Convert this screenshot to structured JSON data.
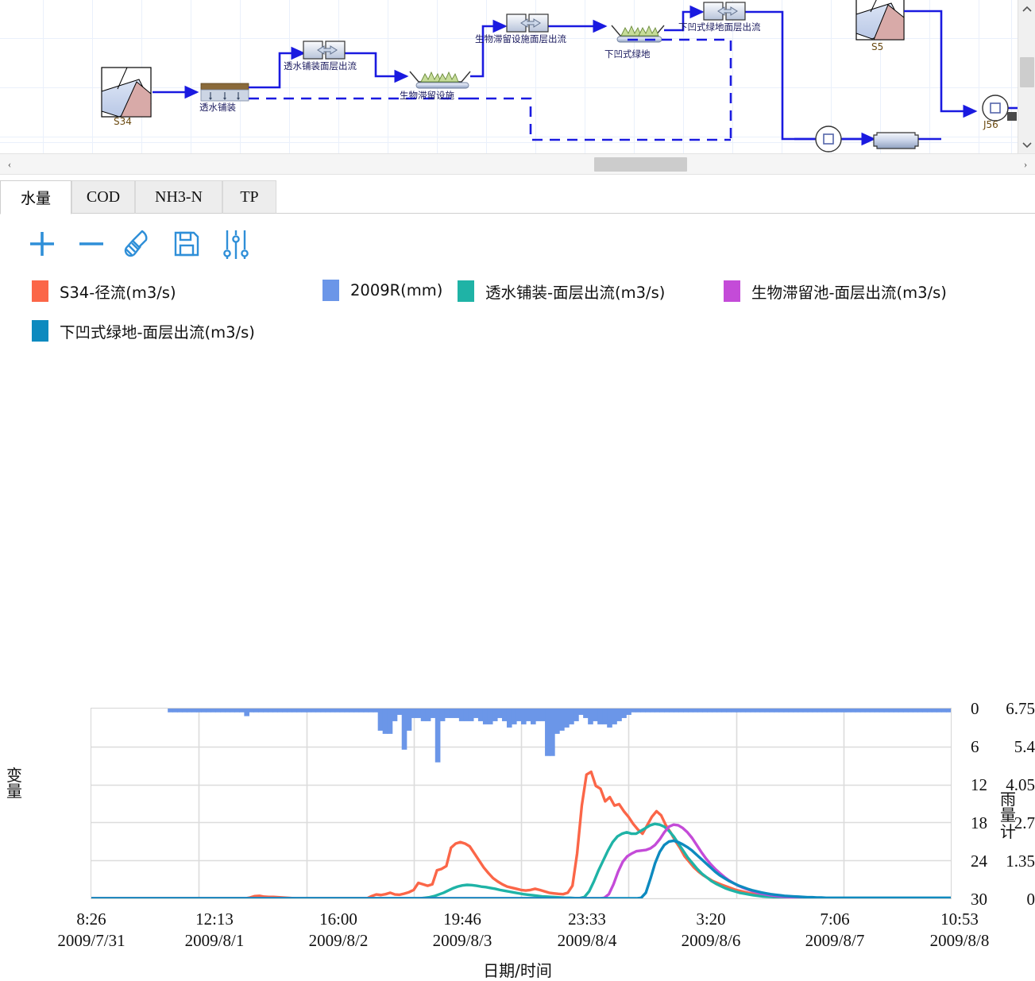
{
  "diagram": {
    "nodes": [
      {
        "id": "s34",
        "label": "S34",
        "type": "subcatchment-icon"
      },
      {
        "id": "permeable",
        "label": "透水铺装",
        "type": "permeable-pavement-icon"
      },
      {
        "id": "bioretention",
        "label": "生物滞留设施",
        "type": "bioretention-icon"
      },
      {
        "id": "sunken",
        "label": "下凹式绿地",
        "type": "sunken-green-icon"
      },
      {
        "id": "s5",
        "label": "S5",
        "type": "subcatchment-icon"
      },
      {
        "id": "j56",
        "label": "J56",
        "type": "junction-icon"
      }
    ],
    "link_labels": [
      "透水铺装面层出流",
      "生物滞留设施面层出流",
      "下凹式绿地面层出流"
    ],
    "scroll": {
      "up": "▲",
      "down": "▼",
      "left": "‹",
      "right": "›"
    }
  },
  "tabs": [
    {
      "label": "水量",
      "active": true
    },
    {
      "label": "COD",
      "active": false
    },
    {
      "label": "NH3-N",
      "active": false
    },
    {
      "label": "TP",
      "active": false
    }
  ],
  "toolbar": [
    {
      "name": "add-series-button",
      "icon": "plus-icon",
      "label": "+"
    },
    {
      "name": "remove-series-button",
      "icon": "minus-icon",
      "label": "−"
    },
    {
      "name": "clear-button",
      "icon": "broom-icon",
      "label": ""
    },
    {
      "name": "save-button",
      "icon": "floppy-disk-icon",
      "label": ""
    },
    {
      "name": "settings-button",
      "icon": "sliders-icon",
      "label": ""
    }
  ],
  "chart_data": {
    "type": "line",
    "title": "",
    "xlabel": "日期/时间",
    "ylabel": "变量",
    "ylabel_right": "雨量计",
    "ylim": [
      0,
      6.75
    ],
    "ylim_right": [
      0,
      30
    ],
    "right_axis_inverted": true,
    "grid": true,
    "legend_position": "top",
    "yticks": [
      "6.75",
      "5.4",
      "4.05",
      "2.7",
      "1.35",
      "0"
    ],
    "yticks_right": [
      "0",
      "6",
      "12",
      "18",
      "24",
      "30"
    ],
    "xticks": [
      {
        "time": "8:26",
        "date": "2009/7/31"
      },
      {
        "time": "12:13",
        "date": "2009/8/1"
      },
      {
        "time": "16:00",
        "date": "2009/8/2"
      },
      {
        "time": "19:46",
        "date": "2009/8/3"
      },
      {
        "time": "23:33",
        "date": "2009/8/4"
      },
      {
        "time": "3:20",
        "date": "2009/8/6"
      },
      {
        "time": "7:06",
        "date": "2009/8/7"
      },
      {
        "time": "10:53",
        "date": "2009/8/8"
      }
    ],
    "series": [
      {
        "name": "S34-径流(m3/s)",
        "color": "#fb6648",
        "axis": "left",
        "render": "line",
        "values": [
          0,
          0,
          0,
          0,
          0,
          0,
          0,
          0,
          0,
          0,
          0,
          0,
          0,
          0,
          0,
          0,
          0,
          0,
          0,
          0,
          0,
          0,
          0,
          0,
          0,
          0,
          0,
          0,
          0,
          0,
          0,
          0,
          0,
          0,
          0.03,
          0.08,
          0.09,
          0.06,
          0.05,
          0.05,
          0.04,
          0.03,
          0.02,
          0.01,
          0,
          0,
          0,
          0,
          0,
          0,
          0,
          0,
          0,
          0,
          0,
          0,
          0,
          0,
          0,
          0,
          0.08,
          0.14,
          0.12,
          0.15,
          0.2,
          0.14,
          0.13,
          0.17,
          0.22,
          0.3,
          0.55,
          0.5,
          0.45,
          0.5,
          1.0,
          1.05,
          1.15,
          1.8,
          1.95,
          2.0,
          1.95,
          1.85,
          1.6,
          1.35,
          1.1,
          0.9,
          0.72,
          0.6,
          0.5,
          0.42,
          0.38,
          0.34,
          0.3,
          0.28,
          0.3,
          0.34,
          0.3,
          0.25,
          0.2,
          0.18,
          0.16,
          0.15,
          0.2,
          0.45,
          1.6,
          3.3,
          4.4,
          4.5,
          4.0,
          3.9,
          3.45,
          3.6,
          3.3,
          3.35,
          3.1,
          2.9,
          2.65,
          2.45,
          2.3,
          2.6,
          2.9,
          3.1,
          2.95,
          2.6,
          2.35,
          2.05,
          1.8,
          1.5,
          1.3,
          1.1,
          0.95,
          0.82,
          0.72,
          0.62,
          0.55,
          0.48,
          0.42,
          0.36,
          0.3,
          0.26,
          0.22,
          0.18,
          0.15,
          0.12,
          0.1,
          0.08,
          0.06,
          0.05,
          0.04,
          0.03,
          0.02,
          0.02,
          0.01,
          0.01,
          0,
          0,
          0,
          0,
          0,
          0,
          0,
          0,
          0,
          0,
          0,
          0,
          0,
          0,
          0,
          0,
          0,
          0,
          0,
          0,
          0,
          0,
          0,
          0,
          0,
          0,
          0,
          0,
          0,
          0,
          0
        ]
      },
      {
        "name": "2009R(mm)",
        "color": "#6b96e8",
        "axis": "right",
        "render": "bar-down",
        "values": [
          0,
          0,
          0,
          0,
          0,
          0,
          0,
          0,
          0,
          0,
          0,
          0,
          0,
          0,
          0,
          0,
          0.6,
          0.6,
          0.6,
          0.6,
          0.6,
          0.6,
          0.6,
          0.6,
          0.6,
          0.6,
          0.6,
          0.6,
          0.6,
          0.6,
          0.6,
          0.6,
          1.2,
          0.6,
          0.6,
          0.6,
          0.6,
          0.6,
          0.6,
          0.6,
          0.6,
          0.6,
          0.6,
          0.6,
          0.6,
          0.6,
          0.6,
          0.6,
          0.6,
          0.6,
          0.6,
          0.6,
          0.6,
          0.6,
          0.6,
          0.6,
          0.6,
          0.6,
          0.6,
          0.6,
          3.5,
          4.0,
          4.0,
          2.0,
          1.0,
          6.5,
          3.5,
          1.5,
          1.5,
          2.0,
          2.0,
          1.5,
          8.5,
          2.0,
          1.5,
          1.5,
          1.5,
          2.0,
          2.0,
          2.0,
          1.5,
          2.0,
          2.5,
          2.5,
          2.0,
          1.5,
          2.0,
          3.0,
          2.5,
          2.0,
          2.5,
          2.0,
          2.5,
          2.0,
          2.0,
          7.5,
          7.5,
          4.0,
          3.5,
          3.0,
          2.5,
          2.0,
          1.0,
          1.5,
          2.5,
          2.0,
          2.5,
          2.5,
          3.0,
          2.5,
          2.0,
          1.5,
          1.0,
          0.6,
          0.6,
          0.6,
          0.6,
          0.6,
          0.6,
          0.6,
          0.6,
          0.6,
          0.6,
          0.6,
          0.6,
          0.6,
          0.6,
          0.6,
          0.6,
          0.6,
          0.6,
          0.6,
          0.6,
          0.6,
          0.6,
          0.6,
          0.6,
          0.6,
          0.6,
          0.6,
          0.6,
          0.6,
          0.6,
          0.6,
          0.6,
          0.6,
          0.6,
          0.6,
          0.6,
          0.6,
          0.6,
          0.6,
          0.6,
          0.6,
          0.6,
          0.6,
          0.6,
          0.6,
          0.6,
          0.6,
          0.6,
          0.6,
          0.6,
          0.6,
          0.6,
          0.6,
          0.6,
          0.6,
          0.6,
          0.6,
          0.6,
          0.6,
          0.6,
          0.6,
          0.6,
          0.6,
          0.6,
          0.6,
          0.6,
          0.6
        ]
      },
      {
        "name": "透水铺装-面层出流(m3/s)",
        "color": "#1fb3a6",
        "axis": "left",
        "render": "line",
        "values": [
          0,
          0,
          0,
          0,
          0,
          0,
          0,
          0,
          0,
          0,
          0,
          0,
          0,
          0,
          0,
          0,
          0,
          0,
          0,
          0,
          0,
          0,
          0,
          0,
          0,
          0,
          0,
          0,
          0,
          0,
          0,
          0,
          0,
          0,
          0,
          0,
          0,
          0,
          0,
          0,
          0,
          0,
          0,
          0,
          0,
          0,
          0,
          0,
          0,
          0,
          0,
          0,
          0,
          0,
          0,
          0,
          0,
          0,
          0,
          0,
          0,
          0,
          0,
          0,
          0,
          0,
          0,
          0,
          0,
          0,
          0,
          0.02,
          0.04,
          0.08,
          0.14,
          0.2,
          0.28,
          0.36,
          0.42,
          0.46,
          0.48,
          0.47,
          0.45,
          0.42,
          0.4,
          0.37,
          0.34,
          0.3,
          0.27,
          0.24,
          0.21,
          0.18,
          0.15,
          0.13,
          0.11,
          0.09,
          0.07,
          0.06,
          0.05,
          0.04,
          0.03,
          0.02,
          0.02,
          0.01,
          0.01,
          0.05,
          0.25,
          0.6,
          1.0,
          1.35,
          1.7,
          2.0,
          2.2,
          2.3,
          2.35,
          2.3,
          2.3,
          2.4,
          2.5,
          2.6,
          2.65,
          2.62,
          2.55,
          2.4,
          2.2,
          1.95,
          1.7,
          1.45,
          1.25,
          1.05,
          0.88,
          0.75,
          0.62,
          0.52,
          0.44,
          0.36,
          0.3,
          0.25,
          0.2,
          0.17,
          0.14,
          0.11,
          0.09,
          0.07,
          0.06,
          0.05,
          0.04,
          0.03,
          0.02,
          0.02,
          0.01,
          0.01,
          0.01,
          0,
          0,
          0,
          0,
          0,
          0,
          0,
          0,
          0,
          0,
          0,
          0,
          0,
          0,
          0,
          0,
          0,
          0,
          0,
          0,
          0,
          0,
          0,
          0,
          0,
          0,
          0,
          0,
          0,
          0,
          0
        ]
      },
      {
        "name": "生物滞留池-面层出流(m3/s)",
        "color": "#c44bd8",
        "axis": "left",
        "render": "line",
        "values": [
          0,
          0,
          0,
          0,
          0,
          0,
          0,
          0,
          0,
          0,
          0,
          0,
          0,
          0,
          0,
          0,
          0,
          0,
          0,
          0,
          0,
          0,
          0,
          0,
          0,
          0,
          0,
          0,
          0,
          0,
          0,
          0,
          0,
          0,
          0,
          0,
          0,
          0,
          0,
          0,
          0,
          0,
          0,
          0,
          0,
          0,
          0,
          0,
          0,
          0,
          0,
          0,
          0,
          0,
          0,
          0,
          0,
          0,
          0,
          0,
          0,
          0,
          0,
          0,
          0,
          0,
          0,
          0,
          0,
          0,
          0,
          0,
          0,
          0,
          0,
          0,
          0,
          0,
          0,
          0,
          0,
          0,
          0,
          0,
          0,
          0,
          0,
          0,
          0,
          0,
          0,
          0,
          0,
          0,
          0,
          0,
          0,
          0,
          0,
          0,
          0,
          0,
          0,
          0,
          0,
          0,
          0,
          0,
          0,
          0,
          0,
          0.02,
          0.15,
          0.5,
          0.95,
          1.3,
          1.5,
          1.6,
          1.68,
          1.7,
          1.72,
          1.78,
          1.9,
          2.1,
          2.35,
          2.55,
          2.62,
          2.6,
          2.5,
          2.35,
          2.15,
          1.9,
          1.65,
          1.42,
          1.22,
          1.05,
          0.9,
          0.76,
          0.64,
          0.54,
          0.45,
          0.38,
          0.32,
          0.26,
          0.21,
          0.17,
          0.14,
          0.11,
          0.09,
          0.07,
          0.06,
          0.05,
          0.04,
          0.03,
          0.02,
          0.02,
          0.01,
          0.01,
          0,
          0,
          0,
          0,
          0,
          0,
          0,
          0,
          0,
          0,
          0,
          0,
          0,
          0,
          0,
          0,
          0,
          0,
          0,
          0,
          0,
          0,
          0,
          0,
          0,
          0,
          0,
          0,
          0
        ]
      },
      {
        "name": "下凹式绿地-面层出流(m3/s)",
        "color": "#0d8abf",
        "axis": "left",
        "render": "line",
        "values": [
          0,
          0,
          0,
          0,
          0,
          0,
          0,
          0,
          0,
          0,
          0,
          0,
          0,
          0,
          0,
          0,
          0,
          0,
          0,
          0,
          0,
          0,
          0,
          0,
          0,
          0,
          0,
          0,
          0,
          0,
          0,
          0,
          0,
          0,
          0,
          0,
          0,
          0,
          0,
          0,
          0,
          0,
          0,
          0,
          0,
          0,
          0,
          0,
          0,
          0,
          0,
          0,
          0,
          0,
          0,
          0,
          0,
          0,
          0,
          0,
          0,
          0,
          0,
          0,
          0,
          0,
          0,
          0,
          0,
          0,
          0,
          0,
          0,
          0,
          0,
          0,
          0,
          0,
          0,
          0,
          0,
          0,
          0,
          0,
          0,
          0,
          0,
          0,
          0,
          0,
          0,
          0,
          0,
          0,
          0,
          0,
          0,
          0,
          0,
          0,
          0,
          0,
          0,
          0,
          0,
          0,
          0,
          0,
          0,
          0,
          0,
          0,
          0,
          0,
          0,
          0,
          0,
          0,
          0,
          0.02,
          0.2,
          0.7,
          1.25,
          1.65,
          1.9,
          2.02,
          2.05,
          2.0,
          1.92,
          1.82,
          1.7,
          1.55,
          1.4,
          1.25,
          1.1,
          0.95,
          0.82,
          0.72,
          0.62,
          0.54,
          0.46,
          0.4,
          0.34,
          0.29,
          0.25,
          0.21,
          0.18,
          0.15,
          0.13,
          0.11,
          0.09,
          0.08,
          0.07,
          0.06,
          0.05,
          0.04,
          0.04,
          0.03,
          0.03,
          0.02,
          0.02,
          0.02,
          0.02,
          0.02,
          0.02,
          0.02,
          0.02,
          0.02,
          0.02,
          0.02,
          0.02,
          0.02,
          0.02,
          0.02,
          0.02,
          0.02,
          0.02,
          0.02,
          0.02,
          0.02,
          0.02,
          0.02,
          0.02,
          0.02,
          0.02,
          0.02,
          0.02
        ]
      }
    ]
  }
}
